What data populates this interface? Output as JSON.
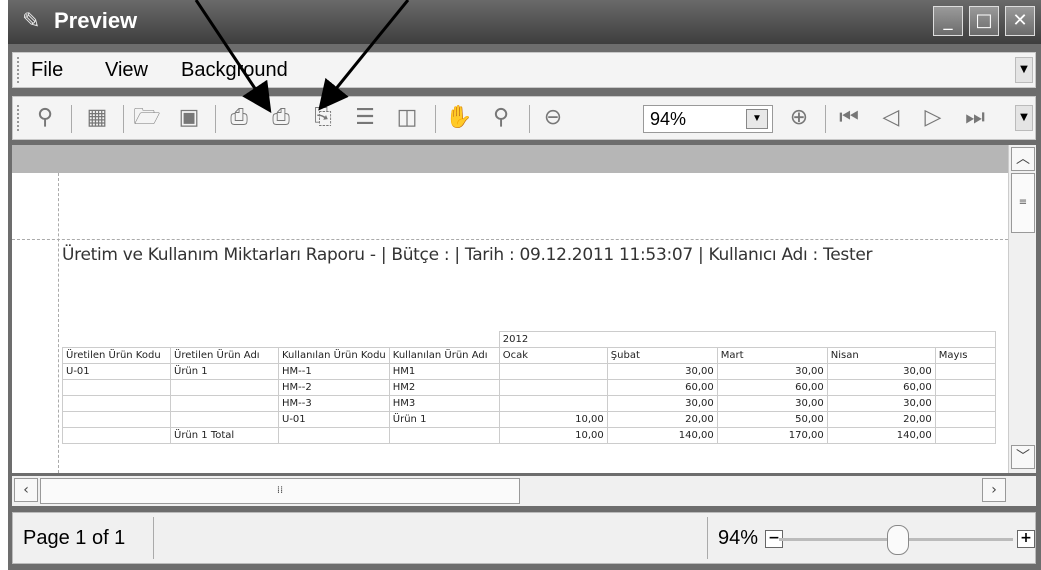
{
  "window": {
    "title": "Preview"
  },
  "menu": {
    "items": [
      "File",
      "View",
      "Background"
    ]
  },
  "toolbar": {
    "zoom_value": "94%"
  },
  "report": {
    "title": "Üretim ve Kullanım Miktarları Raporu - | Bütçe : | Tarih : 09.12.2011 11:53:07 | Kullanıcı Adı : Tester",
    "year": "2012",
    "headers": [
      "Üretilen Ürün Kodu",
      "Üretilen Ürün Adı",
      "Kullanılan Ürün Kodu",
      "Kullanılan Ürün Adı",
      "Ocak",
      "Şubat",
      "Mart",
      "Nisan",
      "Mayıs"
    ],
    "rows": [
      [
        "U-01",
        "Ürün 1",
        "HM--1",
        "HM1",
        "",
        "30,00",
        "30,00",
        "30,00",
        ""
      ],
      [
        "",
        "",
        "HM--2",
        "HM2",
        "",
        "60,00",
        "60,00",
        "60,00",
        ""
      ],
      [
        "",
        "",
        "HM--3",
        "HM3",
        "",
        "30,00",
        "30,00",
        "30,00",
        ""
      ],
      [
        "",
        "",
        "U-01",
        "Ürün 1",
        "10,00",
        "20,00",
        "50,00",
        "20,00",
        ""
      ],
      [
        "",
        "Ürün 1 Total",
        "",
        "",
        "10,00",
        "140,00",
        "170,00",
        "140,00",
        ""
      ]
    ]
  },
  "status": {
    "page": "Page 1 of 1",
    "zoom": "94%"
  }
}
